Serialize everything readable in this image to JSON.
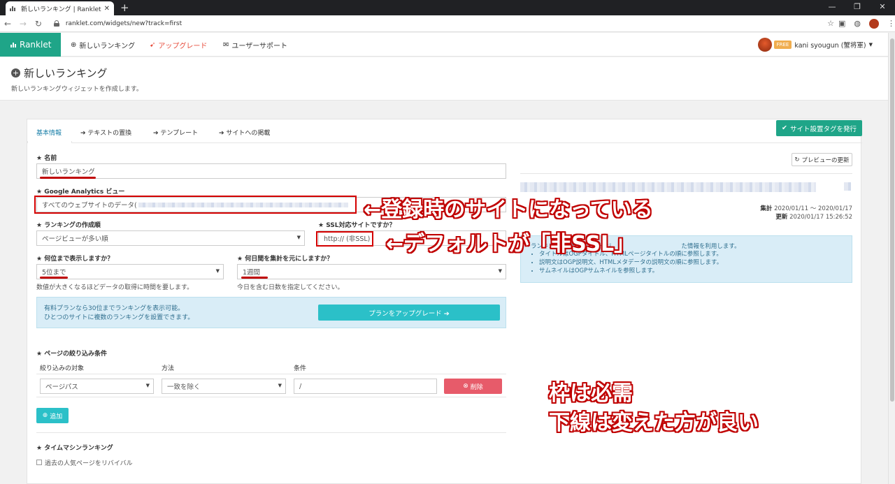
{
  "browser": {
    "tab_title": "新しいランキング | Ranklet [ランクレッ",
    "tab_close": "✕",
    "new_tab": "+",
    "url": "ranklet.com/widgets/new?track=first",
    "window_controls": [
      "—",
      "❐",
      "✕"
    ]
  },
  "nav": {
    "brand": "Ranklet",
    "links": [
      "新しいランキング",
      "アップグレード",
      "ユーザーサポート"
    ],
    "plan_badge": "FREE",
    "user": "kani syougun (蟹将軍)"
  },
  "page": {
    "title": "新しいランキング",
    "subtitle": "新しいランキングウィジェットを作成します。"
  },
  "tabs": [
    "基本情報",
    "テキストの置換",
    "テンプレート",
    "サイトへの掲載"
  ],
  "publish_button": "サイト設置タグを発行",
  "form": {
    "name_label": "名前",
    "name_value": "新しいランキング",
    "ga_label": "Google Analytics ビュー",
    "ga_value": "すべてのウェブサイトのデータ(",
    "order_label": "ランキングの作成順",
    "order_value": "ページビューが多い順",
    "ssl_label": "SSL対応サイトですか？",
    "ssl_value": "http:// (非SSL)",
    "count_label": "何位まで表示しますか？",
    "count_value": "5位まで",
    "count_help": "数値が大きくなるほどデータの取得に時間を要します。",
    "days_label": "何日間を集計を元にしますか？",
    "days_value": "1週間",
    "days_help": "今日を含む日数を指定してください。",
    "info_line1": "有料プランなら30位までランキングを表示可能。",
    "info_line2": "ひとつのサイトに複数のランキングを設置できます。",
    "upgrade_button": "プランをアップグレード ➔",
    "filter_label": "ページの絞り込み条件",
    "filter_headers": [
      "絞り込みの対象",
      "方法",
      "条件"
    ],
    "filter_target": "ページパス",
    "filter_method": "一致を除く",
    "filter_condition": "/",
    "delete_button": "削除",
    "add_button": "追加",
    "timemachine_label": "タイムマシンランキング",
    "timemachine_check": "過去の人気ページをリバイバル"
  },
  "preview": {
    "refresh_button": "プレビューの更新",
    "agg_label": "集計",
    "agg_range": "2020/01/11 〜 2020/01/17",
    "upd_label": "更新",
    "upd_time": "2020/01/17 15:26:52",
    "info_lead": "ランキング",
    "info_mid": "用できるページ",
    "info_tail": "た情報を利用します。",
    "info_items": [
      "タイトルはOGPタイトル、HTMLページタイトルの順に参照します。",
      "説明文はOGP説明文、HTMLメタデータの説明文の順に参照します。",
      "サムネイルはOGPサムネイルを参照します。"
    ]
  },
  "annotations": {
    "arrow1": "←登録時のサイトになっている",
    "arrow2": "←デフォルトが「非SSL」",
    "note_line1": "枠は必需",
    "note_line2": "下線は変えた方が良い"
  },
  "colors": {
    "brand": "#1fa588",
    "annotation_red": "#c00000",
    "info_bg": "#d9edf7",
    "upgrade": "#2bc0c8",
    "delete": "#e75b6a"
  }
}
